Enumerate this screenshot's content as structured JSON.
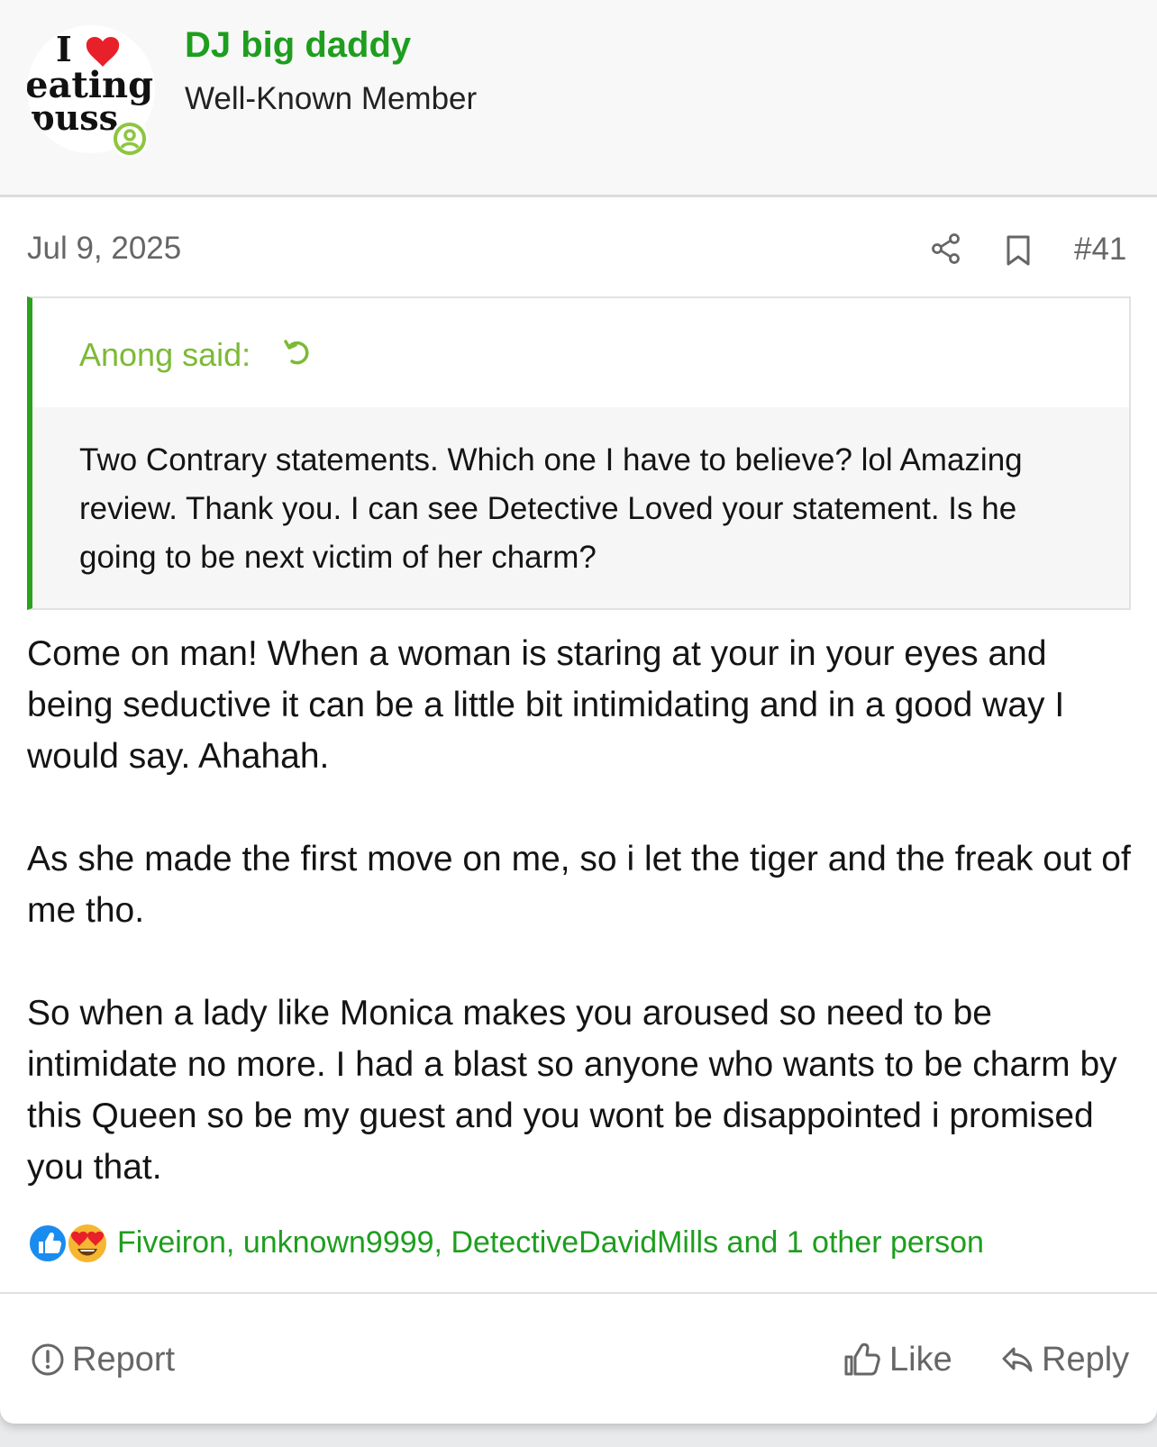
{
  "author": {
    "name": "DJ big daddy",
    "title": "Well-Known Member",
    "avatar_text": [
      "I",
      "eating",
      "puss"
    ],
    "status": "online-icon"
  },
  "post": {
    "date": "Jul 9, 2025",
    "number": "#41",
    "share_icon": "share-icon",
    "bookmark_icon": "bookmark-icon"
  },
  "quote": {
    "author_label": "Anong said:",
    "text": "Two Contrary statements. Which one I have to believe? lol Amazing review. Thank you. I can see Detective Loved your statement. Is he going to be next victim of her charm?"
  },
  "message": {
    "paragraphs": [
      "Come on man! When a woman is staring at your in your eyes and being seductive it can be a little bit intimidating and in a good way I would say. Ahahah.",
      "As she made the first move on me, so i let the tiger and the freak out of me tho.",
      "So when a lady like Monica makes you aroused so need to be intimidate no more. I had a blast so anyone who wants to be charm by this Queen so be my guest and you wont be disappointed i promised you that."
    ]
  },
  "reactions": {
    "icons": [
      "like-reaction-icon",
      "love-reaction-icon"
    ],
    "users_text": "Fiveiron, unknown9999, DetectiveDavidMills and 1 other person"
  },
  "actions": {
    "report": "Report",
    "like": "Like",
    "reply": "Reply"
  },
  "colors": {
    "username": "#1e9e1e",
    "quote_border": "#2aa21e",
    "quote_author": "#7cba35",
    "muted": "#666666"
  }
}
